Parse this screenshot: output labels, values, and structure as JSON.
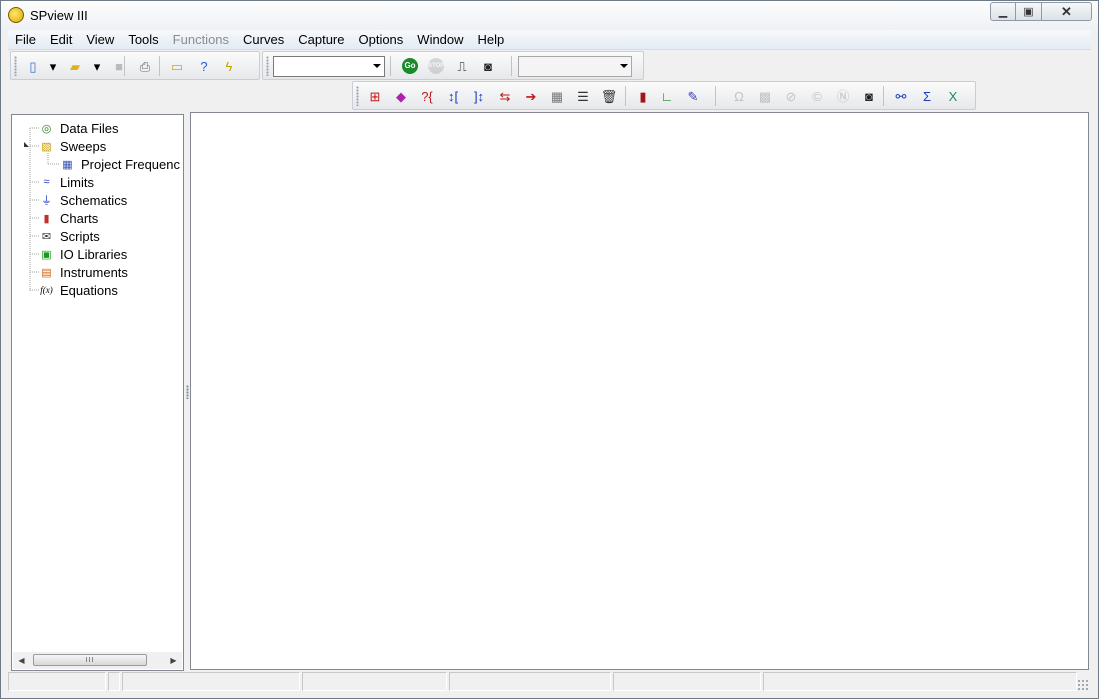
{
  "window": {
    "title": "SPview III"
  },
  "menu": [
    {
      "key": "file",
      "label": "File",
      "enabled": true
    },
    {
      "key": "edit",
      "label": "Edit",
      "enabled": true
    },
    {
      "key": "view",
      "label": "View",
      "enabled": true
    },
    {
      "key": "tools",
      "label": "Tools",
      "enabled": true
    },
    {
      "key": "functions",
      "label": "Functions",
      "enabled": false
    },
    {
      "key": "curves",
      "label": "Curves",
      "enabled": true
    },
    {
      "key": "capture",
      "label": "Capture",
      "enabled": true
    },
    {
      "key": "options",
      "label": "Options",
      "enabled": true
    },
    {
      "key": "window",
      "label": "Window",
      "enabled": true
    },
    {
      "key": "help",
      "label": "Help",
      "enabled": true
    }
  ],
  "toolbar1": {
    "buttons": [
      {
        "name": "new-file",
        "icon": "page-icon",
        "glyph": "▯",
        "color": "#3a6fd0",
        "enabled": true
      },
      {
        "name": "new-dropdown",
        "icon": "chevron-down-icon",
        "glyph": "▾",
        "color": "#000000",
        "enabled": true
      },
      {
        "name": "open-folder",
        "icon": "folder-icon",
        "glyph": "▰",
        "color": "#e0b21a",
        "enabled": true
      },
      {
        "name": "open-dropdown",
        "icon": "chevron-down-icon",
        "glyph": "▾",
        "color": "#000000",
        "enabled": true
      },
      {
        "name": "save",
        "icon": "floppy-icon",
        "glyph": "■",
        "color": "#7a7a7a",
        "enabled": false
      },
      {
        "name": "print",
        "icon": "printer-icon",
        "glyph": "⎙",
        "color": "#6a6a6a",
        "enabled": true
      },
      {
        "name": "clipboard",
        "icon": "clipboard-icon",
        "glyph": "▭",
        "color": "#d9a400",
        "enabled": true
      },
      {
        "name": "help",
        "icon": "help-icon",
        "glyph": "?",
        "color": "#1e5ad6",
        "enabled": true
      },
      {
        "name": "lightning",
        "icon": "lightning-icon",
        "glyph": "ϟ",
        "color": "#c8a000",
        "enabled": true
      }
    ],
    "combo_value": ""
  },
  "toolbar2": {
    "buttons": [
      {
        "name": "go",
        "icon": "go-icon",
        "glyph": "Go",
        "color": "#1a8a2a",
        "enabled": true
      },
      {
        "name": "stop",
        "icon": "stop-icon",
        "glyph": "STOP",
        "color": "#9a9a9a",
        "enabled": false
      },
      {
        "name": "pulse",
        "icon": "pulse-icon",
        "glyph": "⎍",
        "color": "#000000",
        "enabled": true
      },
      {
        "name": "camera",
        "icon": "camera-icon",
        "glyph": "◙",
        "color": "#222222",
        "enabled": true
      }
    ],
    "combo_value": ""
  },
  "toolbar3": {
    "buttons": [
      {
        "name": "marker",
        "icon": "marker-icon",
        "glyph": "⊞",
        "color": "#c01818",
        "enabled": true
      },
      {
        "name": "shapes",
        "icon": "shapes-icon",
        "glyph": "◆",
        "color": "#b020b0",
        "enabled": true
      },
      {
        "name": "query-bracket",
        "icon": "query-bracket-icon",
        "glyph": "?{",
        "color": "#c01818",
        "enabled": true
      },
      {
        "name": "v-bracket",
        "icon": "vertical-bracket-icon",
        "glyph": "↕[",
        "color": "#1a3ac0",
        "enabled": true
      },
      {
        "name": "v-bracket-2",
        "icon": "vertical-bracket-icon",
        "glyph": "]↕",
        "color": "#1a3ac0",
        "enabled": true
      },
      {
        "name": "h-bracket",
        "icon": "horizontal-bracket-icon",
        "glyph": "⇆",
        "color": "#c01818",
        "enabled": true
      },
      {
        "name": "arrow-right",
        "icon": "arrow-right-icon",
        "glyph": "➔",
        "color": "#c01818",
        "enabled": true
      },
      {
        "name": "grid",
        "icon": "grid-icon",
        "glyph": "▦",
        "color": "#777777",
        "enabled": true
      },
      {
        "name": "lines",
        "icon": "list-icon",
        "glyph": "☰",
        "color": "#333333",
        "enabled": true
      },
      {
        "name": "trash",
        "icon": "trash-icon",
        "glyph": "🗑",
        "color": "#333333",
        "enabled": true
      },
      {
        "name": "book",
        "icon": "book-icon",
        "glyph": "▮",
        "color": "#a01818",
        "enabled": true
      },
      {
        "name": "axes",
        "icon": "axes-icon",
        "glyph": "∟",
        "color": "#1a8a2a",
        "enabled": true
      },
      {
        "name": "pen",
        "icon": "pen-icon",
        "glyph": "✎",
        "color": "#3a3ab0",
        "enabled": true
      },
      {
        "name": "omega",
        "icon": "omega-icon",
        "glyph": "Ω",
        "color": "#8a8a8a",
        "enabled": false
      },
      {
        "name": "pattern",
        "icon": "pattern-icon",
        "glyph": "▩",
        "color": "#8a8a8a",
        "enabled": false
      },
      {
        "name": "no-sign",
        "icon": "no-entry-icon",
        "glyph": "⊘",
        "color": "#8a8a8a",
        "enabled": false
      },
      {
        "name": "copyright",
        "icon": "c-circle-icon",
        "glyph": "©",
        "color": "#8a8a8a",
        "enabled": false
      },
      {
        "name": "n-circle",
        "icon": "n-circle-icon",
        "glyph": "Ⓝ",
        "color": "#8a8a8a",
        "enabled": false
      },
      {
        "name": "camera-2",
        "icon": "camera-icon",
        "glyph": "◙",
        "color": "#222222",
        "enabled": true
      },
      {
        "name": "link",
        "icon": "link-icon",
        "glyph": "⚯",
        "color": "#1a3ac0",
        "enabled": true
      },
      {
        "name": "sigma",
        "icon": "sigma-icon",
        "glyph": "Σ",
        "color": "#1a3ac0",
        "enabled": true
      },
      {
        "name": "excel",
        "icon": "excel-icon",
        "glyph": "X",
        "color": "#1a8a6a",
        "enabled": true
      }
    ]
  },
  "tree": [
    {
      "key": "data-files",
      "label": "Data Files",
      "icon": "disc-icon",
      "glyph": "◎",
      "color": "#2a7a2a",
      "level": 0
    },
    {
      "key": "sweeps",
      "label": "Sweeps",
      "icon": "sweep-icon",
      "glyph": "▧",
      "color": "#c89a00",
      "level": 0,
      "expanded": true
    },
    {
      "key": "project-frequency",
      "label": "Project Frequenc",
      "icon": "table-icon",
      "glyph": "▦",
      "color": "#3050b0",
      "level": 1
    },
    {
      "key": "limits",
      "label": "Limits",
      "icon": "limits-icon",
      "glyph": "≈",
      "color": "#1a3ac0",
      "level": 0
    },
    {
      "key": "schematics",
      "label": "Schematics",
      "icon": "schematic-icon",
      "glyph": "⏚",
      "color": "#1a3ac0",
      "level": 0
    },
    {
      "key": "charts",
      "label": "Charts",
      "icon": "bar-chart-icon",
      "glyph": "▮",
      "color": "#c03030",
      "level": 0
    },
    {
      "key": "scripts",
      "label": "Scripts",
      "icon": "scroll-icon",
      "glyph": "✉",
      "color": "#333333",
      "level": 0
    },
    {
      "key": "io-libraries",
      "label": "IO Libraries",
      "icon": "io-board-icon",
      "glyph": "▣",
      "color": "#1a9a1a",
      "level": 0
    },
    {
      "key": "instruments",
      "label": "Instruments",
      "icon": "instrument-icon",
      "glyph": "▤",
      "color": "#d06010",
      "level": 0
    },
    {
      "key": "equations",
      "label": "Equations",
      "icon": "function-icon",
      "glyph": "f(x)",
      "color": "#000000",
      "level": 0
    }
  ],
  "status_cells": [
    "",
    "",
    "",
    "",
    "",
    "",
    ""
  ]
}
